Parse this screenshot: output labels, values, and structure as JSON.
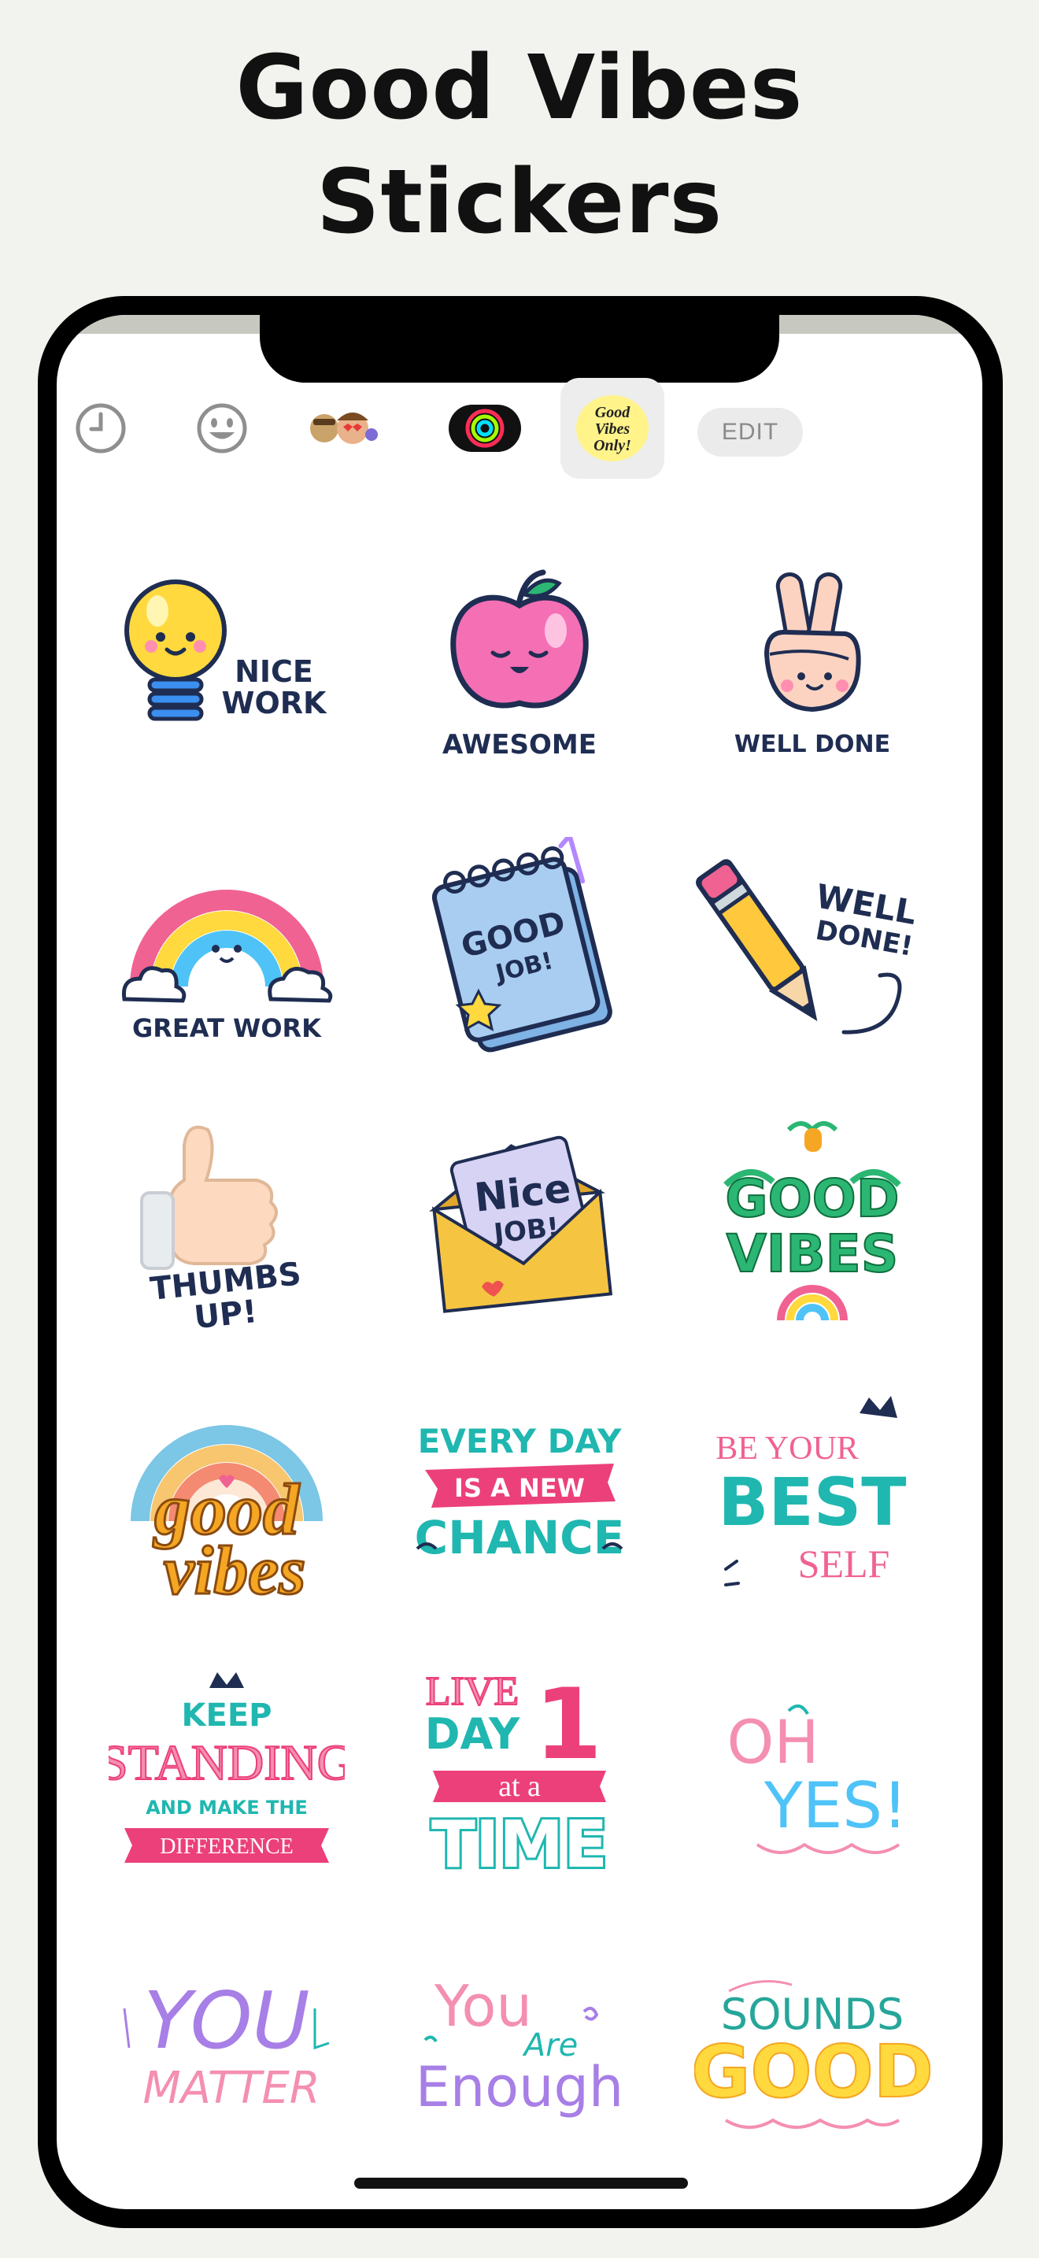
{
  "headline": {
    "line1": "Good Vibes",
    "line2": "Stickers"
  },
  "toolbar": {
    "items": [
      {
        "name": "recents",
        "icon": "clock-icon"
      },
      {
        "name": "emoji",
        "icon": "smiley-icon"
      },
      {
        "name": "memoji",
        "icon": "memoji-faces-icon"
      },
      {
        "name": "activity",
        "icon": "activity-rings-icon"
      },
      {
        "name": "good-vibes-pack",
        "icon": "good-vibes-only-pack-icon",
        "selected": true,
        "pack_text": [
          "Good",
          "Vibes",
          "Only!"
        ]
      }
    ],
    "edit_label": "EDIT"
  },
  "stickers": [
    {
      "id": "nice-work",
      "lines": [
        "NICE",
        "WORK"
      ]
    },
    {
      "id": "awesome",
      "lines": [
        "AWESOME"
      ]
    },
    {
      "id": "well-done-peace",
      "lines": [
        "WELL DONE"
      ]
    },
    {
      "id": "great-work",
      "lines": [
        "GREAT WORK"
      ]
    },
    {
      "id": "good-job-notepad",
      "lines": [
        "GOOD",
        "JOB!"
      ]
    },
    {
      "id": "well-done-pencil",
      "lines": [
        "WELL",
        "DONE!"
      ]
    },
    {
      "id": "thumbs-up",
      "lines": [
        "THUMBS",
        "UP!"
      ]
    },
    {
      "id": "nice-job-envelope",
      "lines": [
        "Nice",
        "JOB!"
      ]
    },
    {
      "id": "good-vibes-green",
      "lines": [
        "GOOD",
        "VIBES"
      ]
    },
    {
      "id": "good-vibes-rainbow",
      "lines": [
        "good",
        "vibes"
      ]
    },
    {
      "id": "every-day-new-chance",
      "lines": [
        "EVERY DAY",
        "IS A NEW",
        "CHANCE"
      ]
    },
    {
      "id": "be-your-best-self",
      "lines": [
        "BE YOUR",
        "BEST",
        "SELF"
      ]
    },
    {
      "id": "keep-standing",
      "lines": [
        "KEEP",
        "STANDING",
        "AND MAKE THE",
        "DIFFERENCE"
      ]
    },
    {
      "id": "live-one-day",
      "lines": [
        "LIVE",
        "DAY",
        "1",
        "at a",
        "TIME"
      ]
    },
    {
      "id": "oh-yes",
      "lines": [
        "OH",
        "YES!"
      ]
    },
    {
      "id": "you-matter",
      "lines": [
        "YOU",
        "MATTER"
      ]
    },
    {
      "id": "you-are-enough",
      "lines": [
        "You",
        "Are",
        "Enough"
      ]
    },
    {
      "id": "sounds-good",
      "lines": [
        "SOUNDS",
        "GOOD"
      ]
    }
  ],
  "colors": {
    "navy": "#1f2d52",
    "pink": "#f06292",
    "teal": "#1fb7b0",
    "yellow": "#ffd93d",
    "purple": "#a77fe6",
    "green": "#2bb673",
    "orange": "#f5a623",
    "blue_paper": "#a9cdf0"
  }
}
